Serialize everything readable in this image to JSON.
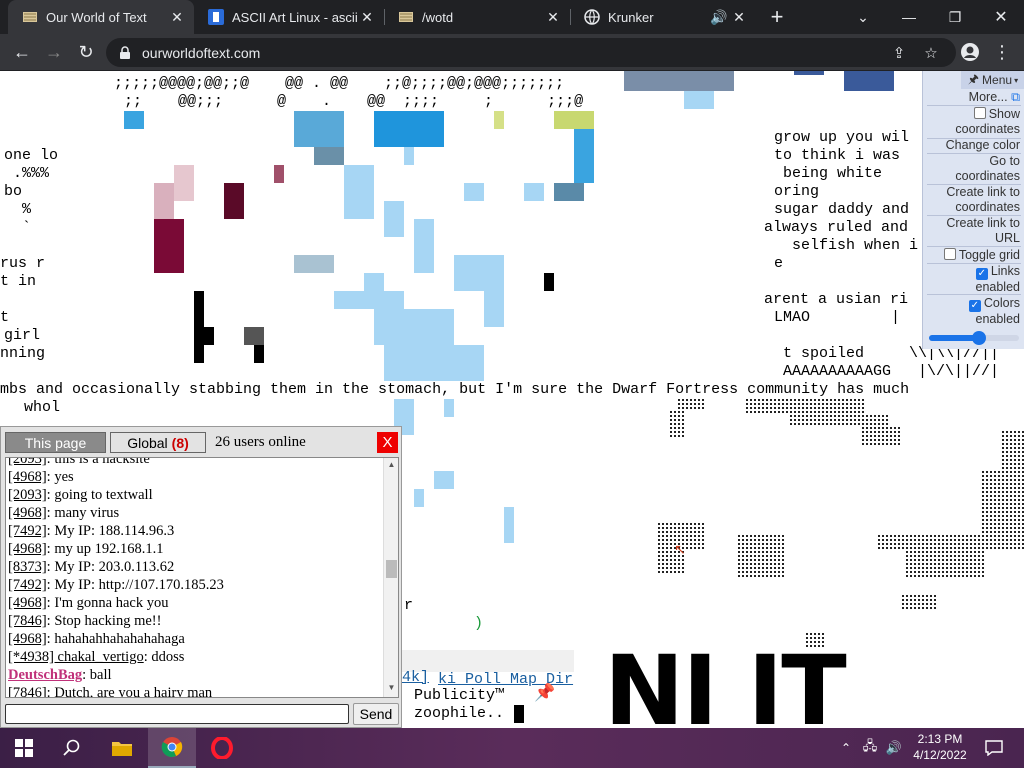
{
  "browser": {
    "tabs": [
      {
        "title": "Our World of Text",
        "active": true,
        "icon": "owot-icon"
      },
      {
        "title": "ASCII Art Linux - asciiar",
        "active": false,
        "icon": "asciiart-icon"
      },
      {
        "title": "/wotd",
        "active": false,
        "icon": "owot-icon"
      },
      {
        "title": "Krunker",
        "active": false,
        "icon": "globe-icon"
      }
    ],
    "url": "ourworldoftext.com"
  },
  "canvas_text": {
    "top_line_1": ";;;;;@@@@;@@;;@    @@ . @@    ;;@;;;;@@;@@@;;;;;;;",
    "top_line_2": ";;    @@;;;      @    .    @@  ;;;;     ;      ;;;@",
    "left_1": "one lo",
    "left_2": " .%%%",
    "left_3": "bo",
    "left_4": "  %",
    "left_5": "  `",
    "left_6": "rus r",
    "left_7": "t in",
    "left_8": "t",
    "left_9": "girl",
    "left_10": "nning",
    "right_1": "grow up you wil",
    "right_2": "to think i was",
    "right_3": " being white",
    "right_4": "oring",
    "right_5": "sugar daddy and",
    "right_6": "always ruled and",
    "right_7": "  selfish when i",
    "right_8": "e",
    "right_9": "arent a usian ri",
    "right_10": "LMAO         |",
    "right_11": " t spoiled     \\\\|\\\\|//||",
    "right_12": " AAAAAAAAAAGG   |\\/\\||//|",
    "wide_line": "mbs and occasionally stabbing them in the stomach, but I'm sure the Dwarf Fortress community has much",
    "wide_line_2": "whol",
    "mid_r": "r",
    "mid_paren": ")",
    "publicity": "Publicity™",
    "zoophile": "zoophile..",
    "links_line": "ki Poll Map Dir",
    "k4_line": "4k]",
    "big_text": "NI IT"
  },
  "menu": {
    "title": "Menu",
    "more": "More...",
    "show_coordinates": "Show coordinates",
    "change_color": "Change color",
    "goto_coordinates": "Go to coordinates",
    "link_coordinates": "Create link to coordinates",
    "link_url": "Create link to URL",
    "toggle_grid": "Toggle grid",
    "links_enabled": "Links enabled",
    "colors_enabled": "Colors enabled",
    "zoom_level": 0.55
  },
  "chat": {
    "tab_this_page": "This page",
    "tab_global": "Global",
    "global_count": "(8)",
    "users_online": "26 users online",
    "close": "X",
    "send": "Send",
    "messages": [
      {
        "id": "[2093]",
        "text": "this is a hacksite",
        "special": false
      },
      {
        "id": "[4968]",
        "text": "yes",
        "special": false
      },
      {
        "id": "[2093]",
        "text": "going to textwall",
        "special": false
      },
      {
        "id": "[4968]",
        "text": "many virus",
        "special": false
      },
      {
        "id": "[7492]",
        "text": "My IP: 188.114.96.3",
        "special": false
      },
      {
        "id": "[4968]",
        "text": "my up 192.168.1.1",
        "special": false
      },
      {
        "id": "[8373]",
        "text": "My IP: 203.0.113.62",
        "special": false
      },
      {
        "id": "[7492]",
        "text": "My IP: http://107.170.185.23",
        "special": false
      },
      {
        "id": "[4968]",
        "text": "I'm gonna hack you",
        "special": false
      },
      {
        "id": "[7846]",
        "text": "Stop hacking me!!",
        "special": false
      },
      {
        "id": "[4968]",
        "text": "hahahahhahahahahaga",
        "special": false
      },
      {
        "id": "[*4938] chakal_vertigo",
        "text": "ddoss",
        "special": false
      },
      {
        "id": "DeutschBag",
        "text": "ball",
        "special": true
      },
      {
        "id": "[7846]",
        "text": "Dutch, are you a hairy man",
        "special": false
      }
    ]
  },
  "taskbar": {
    "time": "2:13 PM",
    "date": "4/12/2022"
  },
  "colors": {
    "chrome_dark": "#202124",
    "chrome_mid": "#35363a",
    "light_blue": "#a7d6f4",
    "mid_blue": "#33a1dd",
    "maroon": "#7a0a36"
  }
}
